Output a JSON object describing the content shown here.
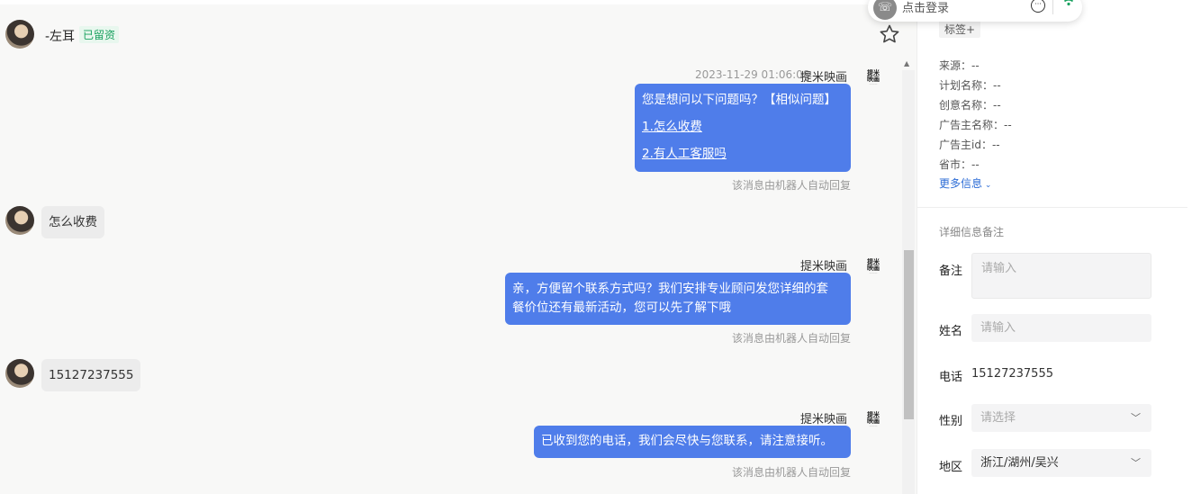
{
  "header": {
    "name": "-左耳",
    "status_tag": "已留资"
  },
  "messages": {
    "bot_name": "提米映画",
    "bot_logo_text": "提米映画",
    "first_time": "2023-11-29 01:06:08",
    "m1": {
      "line1": "您是想问以下问题吗？【相似问题】",
      "link1": "1.怎么收费",
      "link2": "2.有人工客服吗"
    },
    "u1": "怎么收费",
    "m2": {
      "line1": "亲，方便留个联系方式吗？我们安排专业顾问发您详细的套",
      "line2": "餐价位还有最新活动，您可以先了解下哦"
    },
    "u2": "15127237555",
    "m3": "已收到您的电话，我们会尽快与您联系，请注意接听。",
    "auto_reply": "该消息由机器人自动回复"
  },
  "login": {
    "label": "点击登录"
  },
  "panel": {
    "tags_label": "标签+",
    "info": [
      {
        "label": "来源：",
        "value": "--"
      },
      {
        "label": "计划名称：",
        "value": "--"
      },
      {
        "label": "创意名称：",
        "value": "--"
      },
      {
        "label": "广告主名称：",
        "value": "--"
      },
      {
        "label": "广告主id：",
        "value": "--"
      },
      {
        "label": "省市：",
        "value": "--"
      }
    ],
    "more_info": "更多信息",
    "section_title": "详细信息备注",
    "remark_label": "备注",
    "remark_placeholder": "请输入",
    "name_label": "姓名",
    "name_placeholder": "请输入",
    "phone_label": "电话",
    "phone_value": "15127237555",
    "gender_label": "性别",
    "gender_placeholder": "请选择",
    "region_label": "地区",
    "region_value": "浙江/湖州/吴兴"
  },
  "colors": {
    "bot_bubble": "#4f7dea",
    "user_bubble": "#ececec",
    "accent_link": "#2c6cd6",
    "status_green": "#19a15f"
  },
  "icons": [
    "star-icon",
    "phone-icon",
    "more-icon",
    "wifi-icon",
    "chevron-down-icon"
  ]
}
